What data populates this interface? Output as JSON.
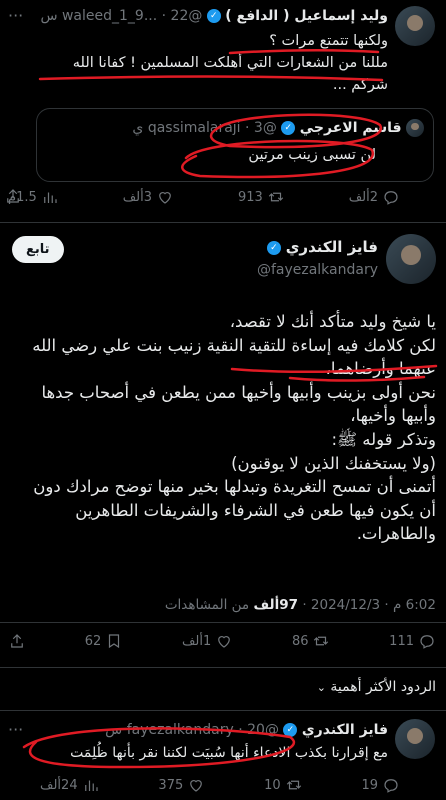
{
  "tweet1": {
    "name": "وليد إسماعيل ( الدافع )",
    "handle": "@waleed_1_9...",
    "time": "22 س",
    "line1": "ولكنها تتمتع مرات ؟",
    "line2": "مللنا من الشعارات التي أهلكت المسلمين ! كفانا الله",
    "line3": "شركم ...",
    "quote": {
      "name": "قاسم الاعرجي",
      "handle": "@qassimalaraji",
      "time": "3 ي",
      "text": "لن تسبى زينب مرتين"
    },
    "actions": {
      "replies": "2ألف",
      "retweets": "913",
      "likes": "3ألف",
      "views": "1.5م"
    }
  },
  "tweet2": {
    "follow_label": "تابع",
    "name": "فايز الكندري",
    "handle": "@fayezalkandary",
    "body": [
      "يا شيخ وليد متأكد أنك لا تقصد،",
      "لكن كلامك فيه إساءة للتقية النقية زنيب بنت علي رضي الله",
      "عنهما وأرضاهما،",
      "نحن أولى بزينب وأبيها وأخيها ممن يطعن في أصحاب جدها",
      "وأبيها وأخيها،",
      "وتذكر قوله ﷺ:",
      "(ولا يستخفنك الذين لا يوقنون)",
      "أتمنى أن تمسح التغريدة وتبدلها بخير منها توضح مرادك دون",
      "أن يكون فيها طعن في الشرفاء والشريفات الطاهرين",
      "والطاهرات."
    ],
    "meta_time": "6:02 م · 2024/12/3",
    "meta_views_count": "97ألف",
    "meta_views_label": "من المشاهدات",
    "actions": {
      "replies": "111",
      "retweets": "86",
      "likes": "1ألف",
      "bookmarks": "62"
    }
  },
  "replies_sort": "الردود الأكثر أهمية",
  "tweet3": {
    "name": "فايز الكندري",
    "handle": "@fayezalkandary",
    "time": "20 س",
    "text": "مع إقرارنا بكذب الادعاء أنها سُبيَت لكننا نقر بأنها ظُلِمَت",
    "actions": {
      "replies": "19",
      "retweets": "10",
      "likes": "375",
      "views": "24ألف"
    }
  }
}
